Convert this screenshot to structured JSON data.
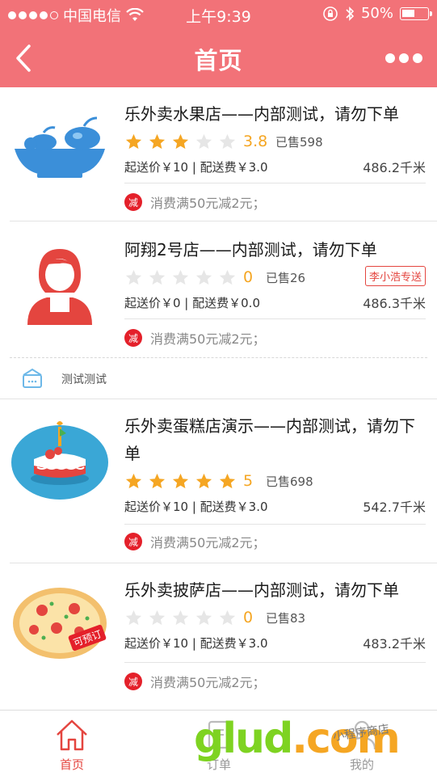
{
  "status_bar": {
    "carrier": "中国电信",
    "time": "上午9:39",
    "battery": "50%"
  },
  "nav": {
    "title": "首页"
  },
  "shops": [
    {
      "name": "乐外卖水果店——内部测试，请勿下单",
      "rating": 3.8,
      "rating_text": "3.8",
      "sold": "已售598",
      "price_info": "起送价￥10 | 配送费￥3.0",
      "distance": "486.2千米",
      "promo": "消费满50元减2元；",
      "promo_icon": "减"
    },
    {
      "name": "阿翔2号店——内部测试，请勿下单",
      "rating": 0,
      "rating_text": "0",
      "sold": "已售26",
      "delivery_badge": "李小浩专送",
      "price_info": "起送价￥0 | 配送费￥0.0",
      "distance": "486.3千米",
      "promo": "消费满50元减2元；",
      "promo_icon": "减"
    },
    {
      "name": "乐外卖蛋糕店演示——内部测试，请勿下单",
      "rating": 5,
      "rating_text": "5",
      "sold": "已售698",
      "price_info": "起送价￥10 | 配送费￥3.0",
      "distance": "542.7千米",
      "promo": "消费满50元减2元；",
      "promo_icon": "减"
    },
    {
      "name": "乐外卖披萨店——内部测试，请勿下单",
      "rating": 0,
      "rating_text": "0",
      "sold": "已售83",
      "logo_tag": "可预订",
      "price_info": "起送价￥10 | 配送费￥3.0",
      "distance": "483.2千米",
      "promo": "消费满50元减2元；",
      "promo_icon": "减"
    }
  ],
  "group": {
    "label": "测试测试"
  },
  "tabbar": {
    "items": [
      {
        "label": "首页",
        "icon": "home-icon"
      },
      {
        "label": "订单",
        "icon": "order-icon"
      },
      {
        "label": "我的",
        "icon": "user-icon"
      }
    ]
  },
  "watermark": {
    "text": "glud",
    "suffix": ".com",
    "handwriting": "小程序商店"
  },
  "colors": {
    "header": "#f27278",
    "accent": "#e4453f",
    "star": "#f5a623",
    "star_empty": "#e6e6e6"
  }
}
